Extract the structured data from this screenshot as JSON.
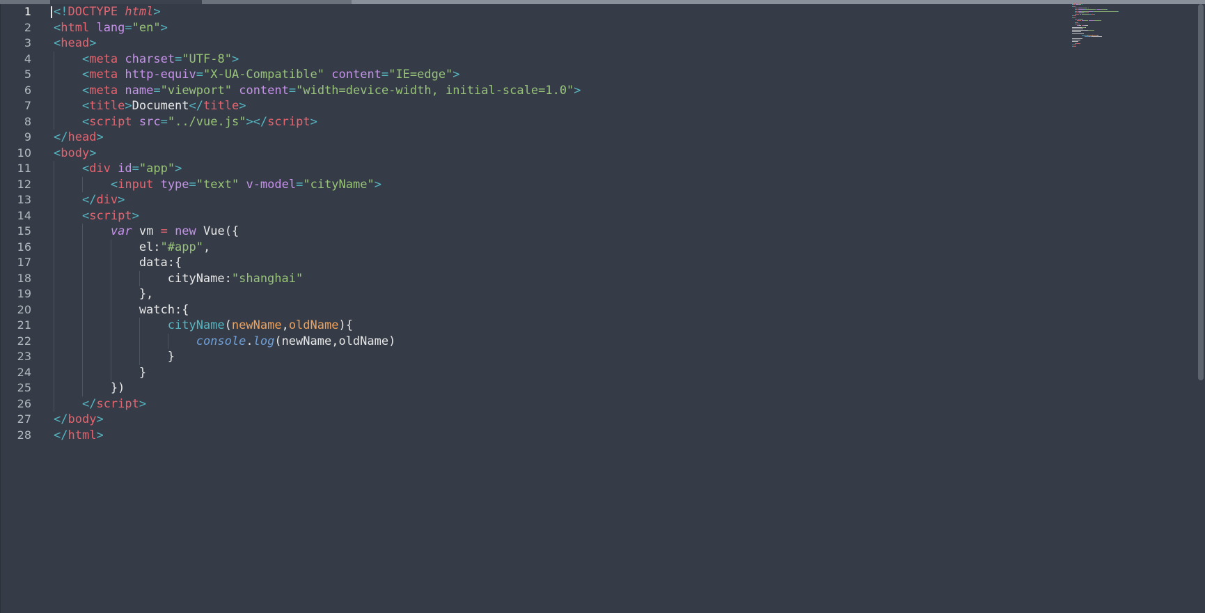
{
  "editor": {
    "line_numbers": [
      "1",
      "2",
      "3",
      "4",
      "5",
      "6",
      "7",
      "8",
      "9",
      "10",
      "11",
      "12",
      "13",
      "14",
      "15",
      "16",
      "17",
      "18",
      "19",
      "20",
      "21",
      "22",
      "23",
      "24",
      "25",
      "26",
      "27",
      "28"
    ],
    "active_line": "1",
    "lines": [
      [
        {
          "c": "t-pun",
          "t": "<!"
        },
        {
          "c": "t-tag",
          "t": "DOCTYPE"
        },
        {
          "c": "t-pl",
          "t": " "
        },
        {
          "c": "t-ital",
          "t": "html"
        },
        {
          "c": "t-pun",
          "t": ">"
        }
      ],
      [
        {
          "c": "t-pun",
          "t": "<"
        },
        {
          "c": "t-tag",
          "t": "html"
        },
        {
          "c": "t-pl",
          "t": " "
        },
        {
          "c": "t-att",
          "t": "lang"
        },
        {
          "c": "t-pun",
          "t": "="
        },
        {
          "c": "t-str",
          "t": "\"en\""
        },
        {
          "c": "t-pun",
          "t": ">"
        }
      ],
      [
        {
          "c": "t-pun",
          "t": "<"
        },
        {
          "c": "t-tag",
          "t": "head"
        },
        {
          "c": "t-pun",
          "t": ">"
        }
      ],
      [
        {
          "c": "t-pl",
          "t": "    "
        },
        {
          "c": "t-pun",
          "t": "<"
        },
        {
          "c": "t-tag",
          "t": "meta"
        },
        {
          "c": "t-pl",
          "t": " "
        },
        {
          "c": "t-att",
          "t": "charset"
        },
        {
          "c": "t-pun",
          "t": "="
        },
        {
          "c": "t-str",
          "t": "\"UTF-8\""
        },
        {
          "c": "t-pun",
          "t": ">"
        }
      ],
      [
        {
          "c": "t-pl",
          "t": "    "
        },
        {
          "c": "t-pun",
          "t": "<"
        },
        {
          "c": "t-tag",
          "t": "meta"
        },
        {
          "c": "t-pl",
          "t": " "
        },
        {
          "c": "t-att",
          "t": "http-equiv"
        },
        {
          "c": "t-pun",
          "t": "="
        },
        {
          "c": "t-str",
          "t": "\"X-UA-Compatible\""
        },
        {
          "c": "t-pl",
          "t": " "
        },
        {
          "c": "t-att",
          "t": "content"
        },
        {
          "c": "t-pun",
          "t": "="
        },
        {
          "c": "t-str",
          "t": "\"IE=edge\""
        },
        {
          "c": "t-pun",
          "t": ">"
        }
      ],
      [
        {
          "c": "t-pl",
          "t": "    "
        },
        {
          "c": "t-pun",
          "t": "<"
        },
        {
          "c": "t-tag",
          "t": "meta"
        },
        {
          "c": "t-pl",
          "t": " "
        },
        {
          "c": "t-att",
          "t": "name"
        },
        {
          "c": "t-pun",
          "t": "="
        },
        {
          "c": "t-str",
          "t": "\"viewport\""
        },
        {
          "c": "t-pl",
          "t": " "
        },
        {
          "c": "t-att",
          "t": "content"
        },
        {
          "c": "t-pun",
          "t": "="
        },
        {
          "c": "t-str",
          "t": "\"width=device-width, initial-scale=1.0\""
        },
        {
          "c": "t-pun",
          "t": ">"
        }
      ],
      [
        {
          "c": "t-pl",
          "t": "    "
        },
        {
          "c": "t-pun",
          "t": "<"
        },
        {
          "c": "t-tag",
          "t": "title"
        },
        {
          "c": "t-pun",
          "t": ">"
        },
        {
          "c": "t-pl",
          "t": "Document"
        },
        {
          "c": "t-pun",
          "t": "</"
        },
        {
          "c": "t-tag",
          "t": "title"
        },
        {
          "c": "t-pun",
          "t": ">"
        }
      ],
      [
        {
          "c": "t-pl",
          "t": "    "
        },
        {
          "c": "t-pun",
          "t": "<"
        },
        {
          "c": "t-tag",
          "t": "script"
        },
        {
          "c": "t-pl",
          "t": " "
        },
        {
          "c": "t-att",
          "t": "src"
        },
        {
          "c": "t-pun",
          "t": "="
        },
        {
          "c": "t-str",
          "t": "\"../vue.js\""
        },
        {
          "c": "t-pun",
          "t": "></"
        },
        {
          "c": "t-tag",
          "t": "script"
        },
        {
          "c": "t-pun",
          "t": ">"
        }
      ],
      [
        {
          "c": "t-pun",
          "t": "</"
        },
        {
          "c": "t-tag",
          "t": "head"
        },
        {
          "c": "t-pun",
          "t": ">"
        }
      ],
      [
        {
          "c": "t-pun",
          "t": "<"
        },
        {
          "c": "t-tag",
          "t": "body"
        },
        {
          "c": "t-pun",
          "t": ">"
        }
      ],
      [
        {
          "c": "t-pl",
          "t": "    "
        },
        {
          "c": "t-pun",
          "t": "<"
        },
        {
          "c": "t-tag",
          "t": "div"
        },
        {
          "c": "t-pl",
          "t": " "
        },
        {
          "c": "t-att",
          "t": "id"
        },
        {
          "c": "t-pun",
          "t": "="
        },
        {
          "c": "t-str",
          "t": "\"app\""
        },
        {
          "c": "t-pun",
          "t": ">"
        }
      ],
      [
        {
          "c": "t-pl",
          "t": "        "
        },
        {
          "c": "t-pun",
          "t": "<"
        },
        {
          "c": "t-tag",
          "t": "input"
        },
        {
          "c": "t-pl",
          "t": " "
        },
        {
          "c": "t-att",
          "t": "type"
        },
        {
          "c": "t-pun",
          "t": "="
        },
        {
          "c": "t-str",
          "t": "\"text\""
        },
        {
          "c": "t-pl",
          "t": " "
        },
        {
          "c": "t-att",
          "t": "v-model"
        },
        {
          "c": "t-pun",
          "t": "="
        },
        {
          "c": "t-str",
          "t": "\"cityName\""
        },
        {
          "c": "t-pun",
          "t": ">"
        }
      ],
      [
        {
          "c": "t-pl",
          "t": "    "
        },
        {
          "c": "t-pun",
          "t": "</"
        },
        {
          "c": "t-tag",
          "t": "div"
        },
        {
          "c": "t-pun",
          "t": ">"
        }
      ],
      [
        {
          "c": "t-pl",
          "t": "    "
        },
        {
          "c": "t-pun",
          "t": "<"
        },
        {
          "c": "t-tag",
          "t": "script"
        },
        {
          "c": "t-pun",
          "t": ">"
        }
      ],
      [
        {
          "c": "t-pl",
          "t": "        "
        },
        {
          "c": "t-kw",
          "t": "var"
        },
        {
          "c": "t-pl",
          "t": " vm "
        },
        {
          "c": "t-op",
          "t": "="
        },
        {
          "c": "t-pl",
          "t": " "
        },
        {
          "c": "t-kw2",
          "t": "new"
        },
        {
          "c": "t-pl",
          "t": " Vue({"
        }
      ],
      [
        {
          "c": "t-pl",
          "t": "            el:"
        },
        {
          "c": "t-str",
          "t": "\"#app\""
        },
        {
          "c": "t-pl",
          "t": ","
        }
      ],
      [
        {
          "c": "t-pl",
          "t": "            data:{"
        }
      ],
      [
        {
          "c": "t-pl",
          "t": "                cityName:"
        },
        {
          "c": "t-str",
          "t": "\"shanghai\""
        }
      ],
      [
        {
          "c": "t-pl",
          "t": "            },"
        }
      ],
      [
        {
          "c": "t-pl",
          "t": "            watch:{"
        }
      ],
      [
        {
          "c": "t-pl",
          "t": "                "
        },
        {
          "c": "t-fn",
          "t": "cityName"
        },
        {
          "c": "t-pl",
          "t": "("
        },
        {
          "c": "t-arg",
          "t": "newName"
        },
        {
          "c": "t-pl",
          "t": ","
        },
        {
          "c": "t-arg",
          "t": "oldName"
        },
        {
          "c": "t-pl",
          "t": "){"
        }
      ],
      [
        {
          "c": "t-pl",
          "t": "                    "
        },
        {
          "c": "t-bi",
          "t": "console"
        },
        {
          "c": "t-pl",
          "t": "."
        },
        {
          "c": "t-bi",
          "t": "log"
        },
        {
          "c": "t-pl",
          "t": "(newName,oldName)"
        }
      ],
      [
        {
          "c": "t-pl",
          "t": "                }"
        }
      ],
      [
        {
          "c": "t-pl",
          "t": "            }"
        }
      ],
      [
        {
          "c": "t-pl",
          "t": "        })"
        }
      ],
      [
        {
          "c": "t-pl",
          "t": "    "
        },
        {
          "c": "t-pun",
          "t": "</"
        },
        {
          "c": "t-tag",
          "t": "script"
        },
        {
          "c": "t-pun",
          "t": ">"
        }
      ],
      [
        {
          "c": "t-pun",
          "t": "</"
        },
        {
          "c": "t-tag",
          "t": "body"
        },
        {
          "c": "t-pun",
          "t": ">"
        }
      ],
      [
        {
          "c": "t-pun",
          "t": "</"
        },
        {
          "c": "t-tag",
          "t": "html"
        },
        {
          "c": "t-pun",
          "t": ">"
        }
      ]
    ],
    "indent_guides": [
      [],
      [],
      [],
      [
        1
      ],
      [
        1
      ],
      [
        1
      ],
      [
        1
      ],
      [
        1
      ],
      [],
      [],
      [
        1
      ],
      [
        1,
        2
      ],
      [
        1
      ],
      [
        1
      ],
      [
        1,
        2
      ],
      [
        1,
        2,
        3
      ],
      [
        1,
        2,
        3
      ],
      [
        1,
        2,
        3,
        4
      ],
      [
        1,
        2,
        3
      ],
      [
        1,
        2,
        3
      ],
      [
        1,
        2,
        3,
        4
      ],
      [
        1,
        2,
        3,
        4,
        5
      ],
      [
        1,
        2,
        3,
        4
      ],
      [
        1,
        2,
        3
      ],
      [
        1,
        2
      ],
      [
        1
      ],
      [],
      []
    ]
  },
  "colors": {
    "background": "#353c47",
    "punctuation": "#56b6c2",
    "tag": "#e5646f",
    "attribute": "#c792ea",
    "string": "#98c379",
    "parameter": "#f0a15a",
    "builtin": "#6f9fd8",
    "text": "#e6e6e6"
  }
}
